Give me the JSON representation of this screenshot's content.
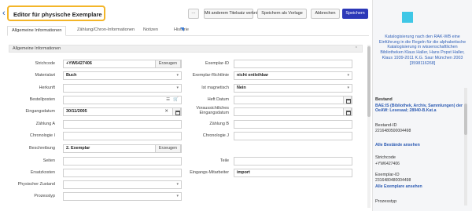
{
  "header": {
    "title": "Editor für physische Exemplare",
    "more_label": "···",
    "link_label": "Mit anderem Titelsatz verknüpfen",
    "template_label": "Speichern als Vorlage",
    "cancel_label": "Abbrechen",
    "save_label": "Speichern"
  },
  "tabs": [
    {
      "label": "Allgemeine Informationen"
    },
    {
      "label": "Zählung/Chron-Informationen"
    },
    {
      "label": "Notizen"
    },
    {
      "label": "Historie"
    }
  ],
  "section": {
    "title": "Allgemeine Informationen"
  },
  "fields": {
    "strichcode": {
      "label": "Strichcode",
      "value": "+YW6427406",
      "button": "Erzeugen"
    },
    "materialart": {
      "label": "Materialart",
      "value": "Buch"
    },
    "herkunft": {
      "label": "Herkunft",
      "value": ""
    },
    "bestellposten": {
      "label": "Bestellposten",
      "value": ""
    },
    "eingangsdatum": {
      "label": "Eingangsdatum",
      "value": "30/11/2005"
    },
    "zaehlung_a": {
      "label": "Zählung A",
      "value": ""
    },
    "chronologie_i": {
      "label": "Chronologie I",
      "value": ""
    },
    "beschreibung": {
      "label": "Beschreibung",
      "value": "2. Exemplar",
      "button": "Erzeugen"
    },
    "seiten": {
      "label": "Seiten",
      "value": ""
    },
    "ersatzkosten": {
      "label": "Ersatzkosten",
      "value": ""
    },
    "physischer_zustand": {
      "label": "Physischer Zustand",
      "value": ""
    },
    "prozesstyp": {
      "label": "Prozesstyp",
      "value": ""
    },
    "exemplar_id": {
      "label": "Exemplar-ID",
      "value": ""
    },
    "exemplar_richtlinie": {
      "label": "Exemplar-Richtlinie",
      "value": "nicht entleihbar"
    },
    "ist_magnetisch": {
      "label": "Ist magnetisch",
      "value": "Nein"
    },
    "heft_datum": {
      "label": "Heft Datum",
      "value": ""
    },
    "vorauss_eingangsdatum": {
      "label": "Voraussichtliches Eingangsdatum",
      "value": ""
    },
    "zaehlung_b": {
      "label": "Zählung B",
      "value": ""
    },
    "chronologie_j": {
      "label": "Chronologie J",
      "value": ""
    },
    "teile": {
      "label": "Teile",
      "value": ""
    },
    "eingangs_mitarbeiter": {
      "label": "Eingangs-Mitarbeiter",
      "value": "import"
    }
  },
  "icons": {
    "list": "list-icon",
    "cart": "cart-icon",
    "clear": "clear-icon",
    "calendar": "calendar-icon",
    "back": "back-arrow-icon"
  },
  "sidebar": {
    "book_description": "Katalogisierung nach den RAK-WB eine Einführung in die Regeln für die alphabetische Katalogisierung in wissenschaftlichen Bibliotheken Klaus Haller, Hans Popst Haller, Klaus 1939-2011 K.G. Saur München 2003 [3598116268]",
    "bestand_label": "Bestand",
    "bestand_value": "BAE:IS (Bibliothek, Archiv, Sammlungen) der OeAW: Lesesaal; 28940-B.Kat.a",
    "bestand_id_label": "Bestand-ID",
    "bestand_id_value": "2216480500004498",
    "all_holdings_link": "Alle Bestände ansehen",
    "strichcode_label": "Strichcode",
    "strichcode_value": "+YW6427406",
    "exemplar_id_label": "Exemplar-ID",
    "exemplar_id_value": "2316480480004498",
    "all_items_link": "Alle Exemplare ansehen",
    "prozesstyp_label": "Prozesstyp"
  },
  "colors": {
    "title_highlight": "#f3b528",
    "primary_button": "#2c38b8",
    "link": "#2e5cb3",
    "cover": "#3fc7e6"
  }
}
